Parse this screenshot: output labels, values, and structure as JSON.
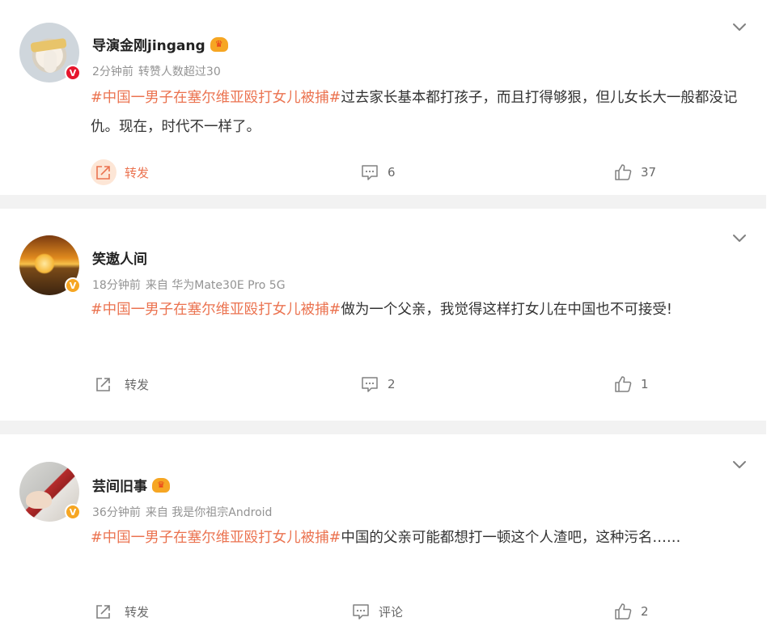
{
  "posts": [
    {
      "username": "导演金刚jingang",
      "has_crown": true,
      "verify_badge": "V",
      "verify_color": "#e6162d",
      "time": "2分钟前",
      "source": "转赞人数超过30",
      "topic": "#中国一男子在塞尔维亚殴打女儿被捕#",
      "text": "过去家长基本都打孩子，而且打得够狠，但儿女长大一般都没记仇。现在，时代不一样了。",
      "forward_label": "转发",
      "comment_count": "6",
      "like_count": "37"
    },
    {
      "username": "笑遨人间",
      "has_crown": false,
      "verify_badge": "V",
      "verify_color": "#f6a623",
      "time": "18分钟前",
      "source": "来自 华为Mate30E Pro 5G",
      "topic": "#中国一男子在塞尔维亚殴打女儿被捕#",
      "text": "做为一个父亲，我觉得这样打女儿在中国也不可接受!",
      "forward_label": "转发",
      "comment_count": "2",
      "like_count": "1"
    },
    {
      "username": "芸间旧事",
      "has_crown": true,
      "verify_badge": "V",
      "verify_color": "#f6a623",
      "time": "36分钟前",
      "source": "来自 我是你祖宗Android",
      "topic": "#中国一男子在塞尔维亚殴打女儿被捕#",
      "text": "中国的父亲可能都想打一顿这个人渣吧，这种污名……",
      "forward_label": "转发",
      "comment_count": "评论",
      "like_count": "2"
    }
  ],
  "icons": {
    "forward": "forward-icon",
    "comment": "comment-icon",
    "like": "thumbs-up-icon",
    "more": "chevron-down-icon",
    "crown": "crown-icon"
  },
  "colors": {
    "topic": "#eb7350",
    "meta": "#939393",
    "action": "#696969",
    "separator": "#f2f2f2"
  }
}
